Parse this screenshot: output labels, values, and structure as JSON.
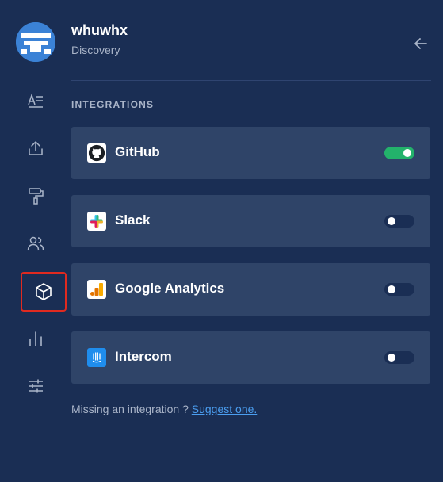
{
  "header": {
    "username": "whuwhx",
    "subtitle": "Discovery"
  },
  "sidebar": {
    "items": [
      {
        "name": "document-settings",
        "icon": "text-align-icon"
      },
      {
        "name": "share",
        "icon": "upload-icon"
      },
      {
        "name": "theme",
        "icon": "paint-roller-icon"
      },
      {
        "name": "members",
        "icon": "users-icon"
      },
      {
        "name": "integrations",
        "icon": "cube-icon",
        "active": true
      },
      {
        "name": "analytics",
        "icon": "bar-chart-icon"
      },
      {
        "name": "advanced",
        "icon": "sliders-icon"
      }
    ]
  },
  "integrations": {
    "section_title": "INTEGRATIONS",
    "items": [
      {
        "label": "GitHub",
        "icon": "github-icon",
        "enabled": true
      },
      {
        "label": "Slack",
        "icon": "slack-icon",
        "enabled": false
      },
      {
        "label": "Google Analytics",
        "icon": "google-analytics-icon",
        "enabled": false
      },
      {
        "label": "Intercom",
        "icon": "intercom-icon",
        "enabled": false
      }
    ]
  },
  "footer": {
    "text": "Missing an integration ? ",
    "link": "Suggest one."
  },
  "colors": {
    "background": "#1a2e54",
    "card": "#2f4468",
    "toggle_on": "#23b26b",
    "link": "#4b9ef0",
    "highlight": "#e02a20"
  }
}
